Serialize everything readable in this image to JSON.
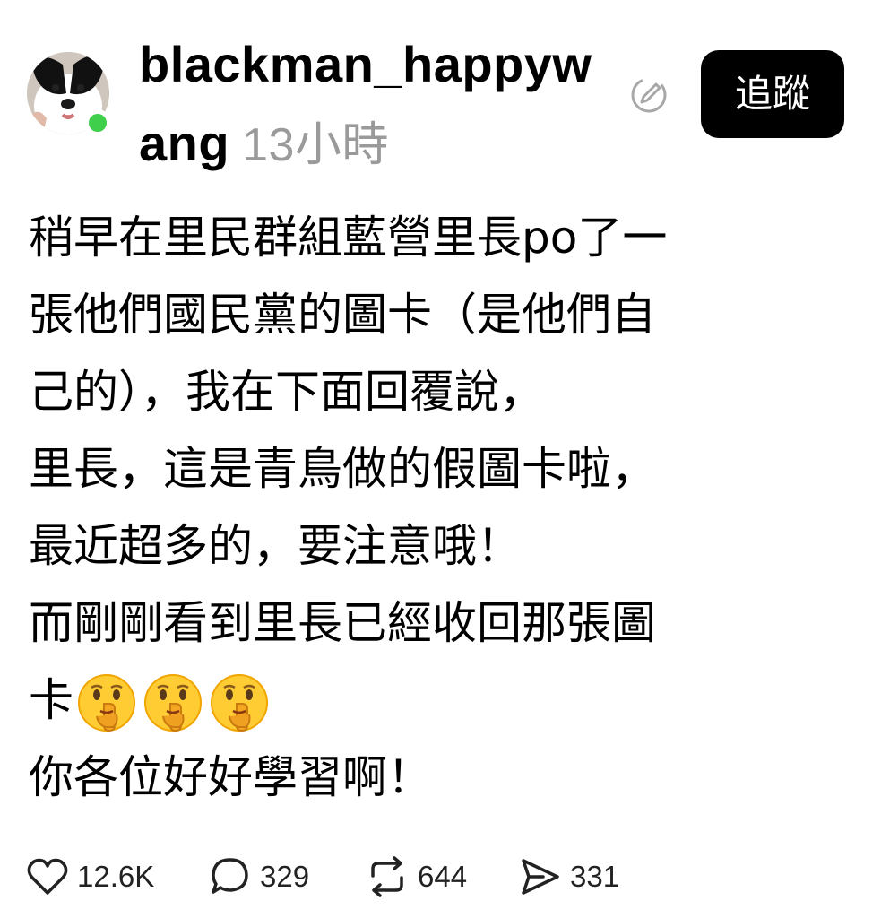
{
  "author": {
    "username_line1": "blackman_happyw",
    "username_line2": "ang",
    "time_ago": "13小時",
    "online_color": "#3fcf4a",
    "avatar_icon": "dog-avatar"
  },
  "header": {
    "edited_icon": "edit-pencil-icon",
    "follow_label": "追蹤"
  },
  "post": {
    "lines": [
      "稍早在里民群組藍營里長po了一",
      "張他們國民黨的圖卡（是他們自",
      "己的），我在下面回覆說，",
      "里長，這是青鳥做的假圖卡啦，",
      "最近超多的，要注意哦！",
      "而剛剛看到里長已經收回那張圖",
      "卡",
      "你各位好好學習啊！"
    ],
    "emojis": [
      "shushing-face",
      "shushing-face",
      "shushing-face"
    ]
  },
  "actions": {
    "likes": "12.6K",
    "comments": "329",
    "reposts": "644",
    "shares": "331"
  }
}
